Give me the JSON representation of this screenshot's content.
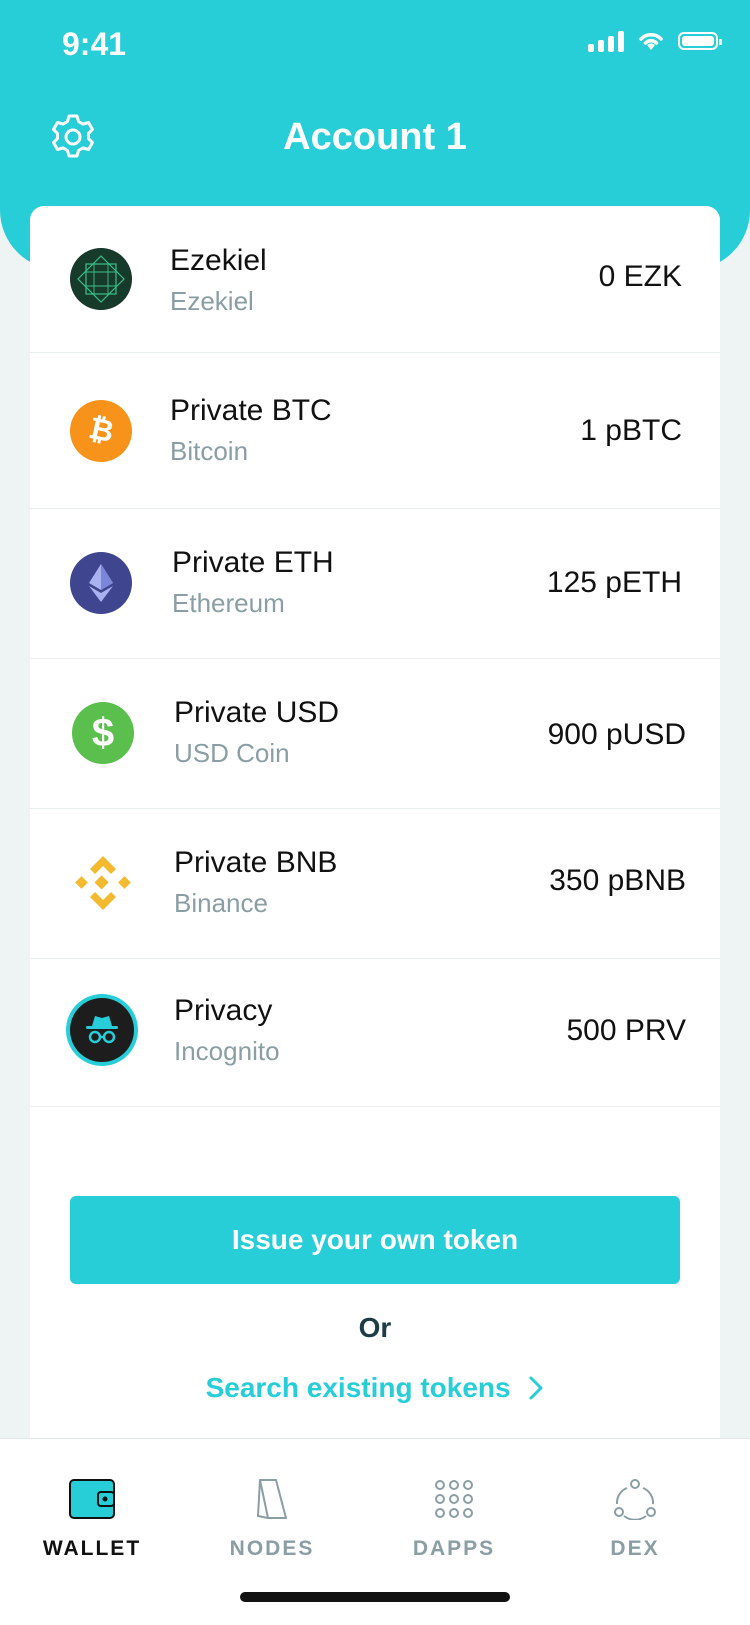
{
  "status": {
    "time": "9:41"
  },
  "header": {
    "title": "Account 1"
  },
  "tokens": [
    {
      "name": "Ezekiel",
      "sub": "Ezekiel",
      "amount": "0 EZK",
      "icon": "ezekiel-icon"
    },
    {
      "name": "Private BTC",
      "sub": "Bitcoin",
      "amount": "1 pBTC",
      "icon": "bitcoin-icon"
    },
    {
      "name": "Private ETH",
      "sub": "Ethereum",
      "amount": "125 pETH",
      "icon": "ethereum-icon"
    },
    {
      "name": "Private USD",
      "sub": "USD Coin",
      "amount": "900 pUSD",
      "icon": "usd-icon"
    },
    {
      "name": "Private BNB",
      "sub": "Binance",
      "amount": "350 pBNB",
      "icon": "binance-icon"
    },
    {
      "name": "Privacy",
      "sub": "Incognito",
      "amount": "500 PRV",
      "icon": "incognito-icon"
    }
  ],
  "actions": {
    "issue_label": "Issue your own token",
    "or_label": "Or",
    "search_label": "Search existing tokens"
  },
  "tabs": [
    {
      "label": "WALLET",
      "icon": "wallet-icon",
      "active": true
    },
    {
      "label": "NODES",
      "icon": "nodes-icon",
      "active": false
    },
    {
      "label": "DAPPS",
      "icon": "dapps-icon",
      "active": false
    },
    {
      "label": "DEX",
      "icon": "dex-icon",
      "active": false
    }
  ],
  "colors": {
    "accent": "#27cdd7",
    "bitcoin": "#f7931a",
    "ethereum": "#3f468f",
    "usd": "#5bbf4e",
    "binance": "#f3ba2f",
    "incognito": "#1d1d1d"
  }
}
